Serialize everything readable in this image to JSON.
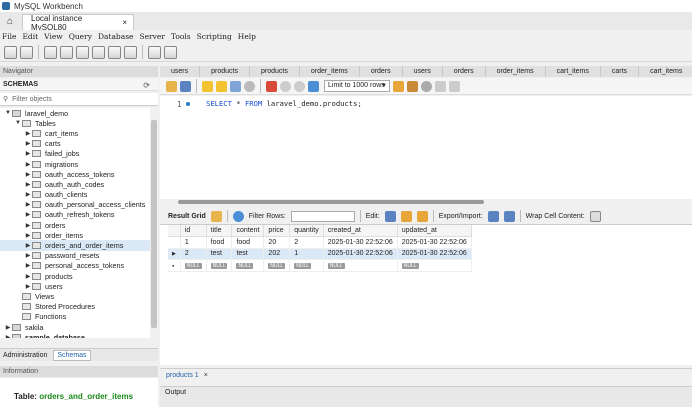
{
  "window": {
    "title": "MySQL Workbench"
  },
  "tabs": {
    "connection": "Local instance MySQL80",
    "close": "×"
  },
  "menu": [
    "File",
    "Edit",
    "View",
    "Query",
    "Database",
    "Server",
    "Tools",
    "Scripting",
    "Help"
  ],
  "navigator": {
    "header": "Navigator",
    "schemas_title": "SCHEMAS",
    "filter_placeholder": "Filter objects",
    "tree": [
      {
        "label": "laravel_demo",
        "level": 0,
        "expanded": true,
        "type": "schema"
      },
      {
        "label": "Tables",
        "level": 1,
        "expanded": true,
        "type": "folder"
      },
      {
        "label": "cart_items",
        "level": 2,
        "type": "table"
      },
      {
        "label": "carts",
        "level": 2,
        "type": "table"
      },
      {
        "label": "failed_jobs",
        "level": 2,
        "type": "table"
      },
      {
        "label": "migrations",
        "level": 2,
        "type": "table"
      },
      {
        "label": "oauth_access_tokens",
        "level": 2,
        "type": "table"
      },
      {
        "label": "oauth_auth_codes",
        "level": 2,
        "type": "table"
      },
      {
        "label": "oauth_clients",
        "level": 2,
        "type": "table"
      },
      {
        "label": "oauth_personal_access_clients",
        "level": 2,
        "type": "table"
      },
      {
        "label": "oauth_refresh_tokens",
        "level": 2,
        "type": "table"
      },
      {
        "label": "orders",
        "level": 2,
        "type": "table"
      },
      {
        "label": "order_items",
        "level": 2,
        "type": "table"
      },
      {
        "label": "orders_and_order_items",
        "level": 2,
        "type": "table",
        "selected": true
      },
      {
        "label": "password_resets",
        "level": 2,
        "type": "table"
      },
      {
        "label": "personal_access_tokens",
        "level": 2,
        "type": "table"
      },
      {
        "label": "products",
        "level": 2,
        "type": "table"
      },
      {
        "label": "users",
        "level": 2,
        "type": "table"
      },
      {
        "label": "Views",
        "level": 1,
        "type": "folder"
      },
      {
        "label": "Stored Procedures",
        "level": 1,
        "type": "folder"
      },
      {
        "label": "Functions",
        "level": 1,
        "type": "folder"
      },
      {
        "label": "sakila",
        "level": 0,
        "type": "schema"
      },
      {
        "label": "sample_database",
        "level": 0,
        "type": "schema"
      }
    ],
    "bottom_tabs": [
      "Administration",
      "Schemas"
    ],
    "info_header": "Information",
    "info_prefix": "Table:",
    "info_table": "orders_and_order_items"
  },
  "query_tabs": [
    "users",
    "products",
    "products",
    "order_items",
    "orders",
    "users",
    "orders",
    "order_items",
    "cart_items",
    "carts",
    "cart_items"
  ],
  "query_toolbar": {
    "limit": "Limit to 1000 rows"
  },
  "editor": {
    "line": "1",
    "keyword1": "SELECT",
    "star": " * ",
    "keyword2": "FROM",
    "rest": " laravel_demo.products;"
  },
  "result_toolbar": {
    "result_grid": "Result Grid",
    "filter_rows": "Filter Rows:",
    "edit": "Edit:",
    "export": "Export/Import:",
    "wrap": "Wrap Cell Content:"
  },
  "grid": {
    "columns": [
      "id",
      "title",
      "content",
      "price",
      "quantity",
      "created_at",
      "updated_at"
    ],
    "rows": [
      [
        "1",
        "food",
        "food",
        "20",
        "2",
        "2025-01-30 22:52:06",
        "2025-01-30 22:52:06"
      ],
      [
        "2",
        "test",
        "test",
        "202",
        "1",
        "2025-01-30 22:52:06",
        "2025-01-30 22:52:06"
      ]
    ],
    "null_label": "NULL"
  },
  "bottom": {
    "result_tab": "products 1",
    "close": "×",
    "output": "Output"
  }
}
